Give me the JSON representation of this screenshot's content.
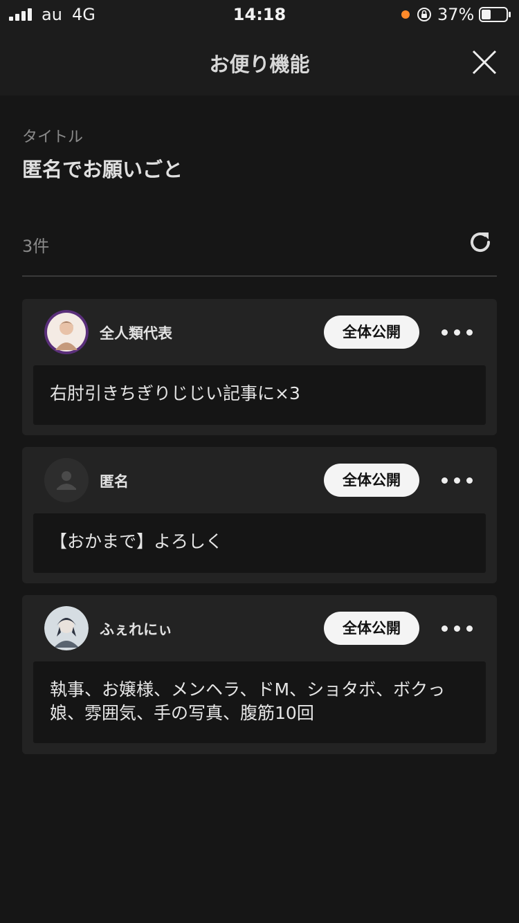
{
  "status_bar": {
    "carrier": "au",
    "network": "4G",
    "time": "14:18",
    "battery": "37%",
    "dot_color": "#ff8a2a"
  },
  "header": {
    "title": "お便り機能",
    "close_icon": "close-icon"
  },
  "title_section": {
    "label": "タイトル",
    "value": "匿名でお願いごと"
  },
  "list_header": {
    "count": "3件",
    "refresh_icon": "refresh-icon"
  },
  "messages": [
    {
      "username": "全人類代表",
      "visibility": "全体公開",
      "text": "右肘引きちぎりじじい記事に×3",
      "avatar": "illustrated-avatar"
    },
    {
      "username": "匿名",
      "visibility": "全体公開",
      "text": "【おかまで】よろしく",
      "avatar": "default-person-icon"
    },
    {
      "username": "ふぇれにぃ",
      "visibility": "全体公開",
      "text": "執事、お嬢様、メンヘラ、ドM、ショタボ、ボクっ娘、雰囲気、手の写真、腹筋10回",
      "avatar": "illustrated-avatar"
    }
  ]
}
